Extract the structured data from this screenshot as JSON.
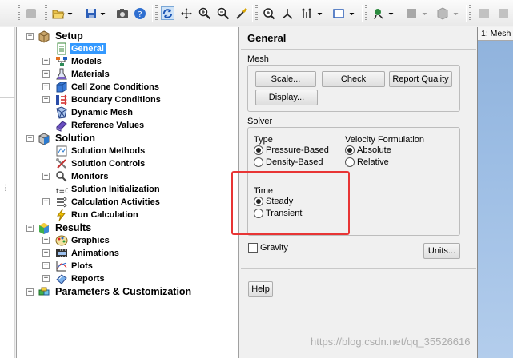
{
  "tree": {
    "setup": {
      "label": "Setup",
      "items": {
        "general": "General",
        "models": "Models",
        "materials": "Materials",
        "cell_zone": "Cell Zone Conditions",
        "boundary": "Boundary Conditions",
        "dynamic_mesh": "Dynamic Mesh",
        "reference": "Reference Values"
      }
    },
    "solution": {
      "label": "Solution",
      "items": {
        "methods": "Solution Methods",
        "controls": "Solution Controls",
        "monitors": "Monitors",
        "init": "Solution Initialization",
        "activities": "Calculation Activities",
        "run": "Run Calculation"
      }
    },
    "results": {
      "label": "Results",
      "items": {
        "graphics": "Graphics",
        "animations": "Animations",
        "plots": "Plots",
        "reports": "Reports"
      }
    },
    "params": {
      "label": "Parameters & Customization"
    }
  },
  "panel": {
    "title": "General",
    "mesh": {
      "label": "Mesh",
      "scale": "Scale...",
      "check": "Check",
      "report_quality": "Report Quality",
      "display": "Display..."
    },
    "solver": {
      "label": "Solver",
      "type_label": "Type",
      "type_options": {
        "pressure": "Pressure-Based",
        "density": "Density-Based"
      },
      "type_selected": "Pressure-Based",
      "velocity_label": "Velocity Formulation",
      "velocity_options": {
        "absolute": "Absolute",
        "relative": "Relative"
      },
      "velocity_selected": "Absolute",
      "time_label": "Time",
      "time_options": {
        "steady": "Steady",
        "transient": "Transient"
      },
      "time_selected": "Steady"
    },
    "gravity_label": "Gravity",
    "gravity_checked": false,
    "units_button": "Units...",
    "help_button": "Help"
  },
  "graphics": {
    "tab_label": "1: Mesh"
  },
  "watermark": "https://blog.csdn.net/qq_35526616",
  "colors": {
    "selection": "#3399ff",
    "highlight_box": "#e83535"
  }
}
